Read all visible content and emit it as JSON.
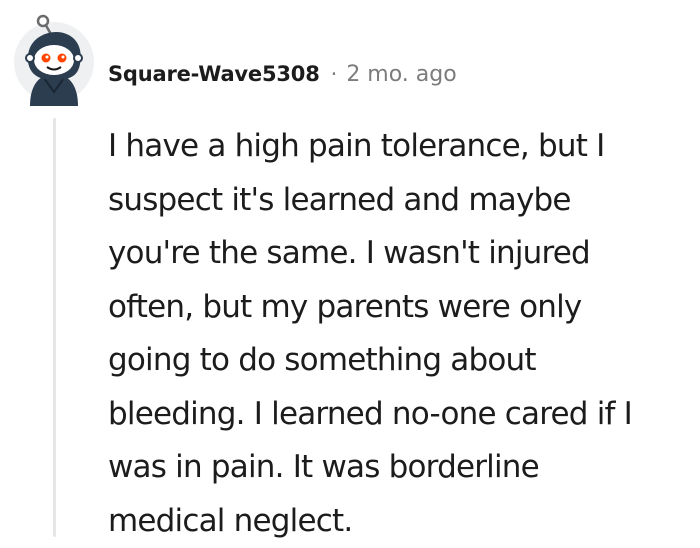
{
  "comment": {
    "author": "Square-Wave5308",
    "separator": "·",
    "timestamp": "2 mo. ago",
    "avatar_icon": "snoo-avatar-icon",
    "body_lines": [
      "I have a high pain tolerance, but I",
      "suspect it's learned and maybe",
      "you're the same. I wasn't injured",
      "often, but my parents were only",
      "going to do something about",
      "bleeding. I learned no-one cared if I",
      "was in pain. It was borderline",
      "medical neglect."
    ]
  },
  "colors": {
    "text": "#1c1c1c",
    "meta": "#7c7c7c",
    "thread_line": "#e4e6e8",
    "avatar_accent": "#ff4500",
    "avatar_hoodie": "#2b3d4f"
  }
}
